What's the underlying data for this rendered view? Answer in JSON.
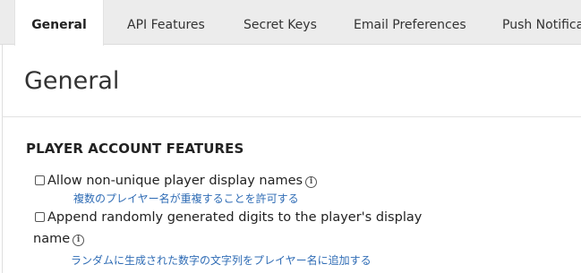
{
  "tabs": [
    {
      "label": "General",
      "active": true
    },
    {
      "label": "API Features",
      "active": false
    },
    {
      "label": "Secret Keys",
      "active": false
    },
    {
      "label": "Email Preferences",
      "active": false
    },
    {
      "label": "Push Notificat",
      "active": false
    }
  ],
  "page": {
    "title": "General"
  },
  "section": {
    "heading": "PLAYER ACCOUNT FEATURES"
  },
  "features": [
    {
      "label": "Allow non-unique player display names",
      "translation": "複数のプレイヤー名が重複することを許可する",
      "checked": false,
      "info_icon": "info-circle-icon"
    },
    {
      "label_line1": "Append randomly generated digits to the player's display",
      "label_line2": "name",
      "translation": "ランダムに生成された数字の文字列をプレイヤー名に追加する",
      "checked": false,
      "info_icon": "info-circle-icon"
    }
  ],
  "colors": {
    "tabbar_bg": "#ececec",
    "translation_text": "#2f6cb5"
  }
}
